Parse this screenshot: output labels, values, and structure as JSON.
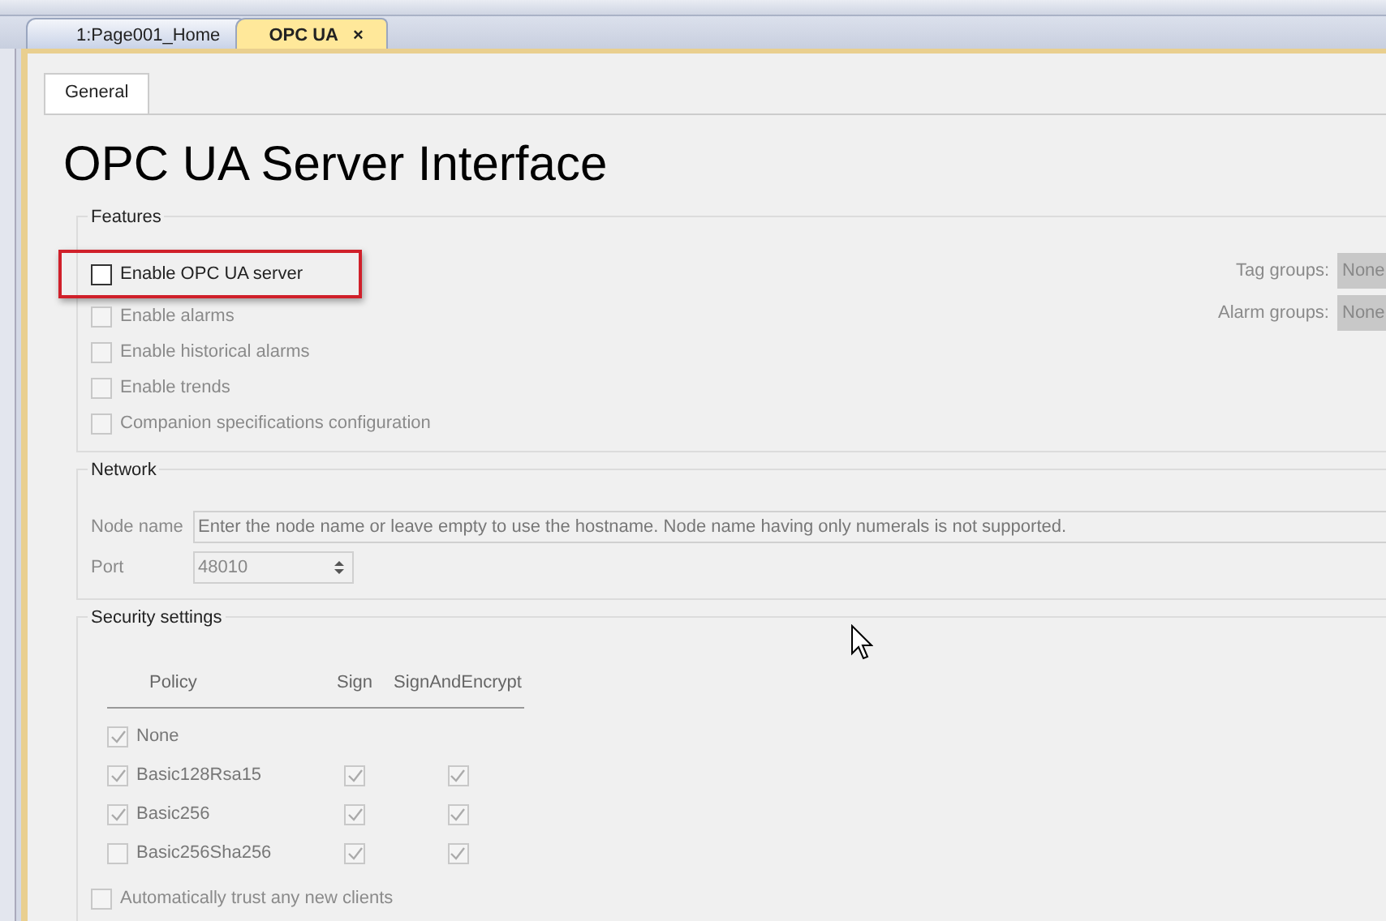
{
  "document_tabs": [
    {
      "label": "1:Page001_Home",
      "selected": false
    },
    {
      "label": "OPC UA",
      "selected": true,
      "close": "×"
    }
  ],
  "page_tabs": [
    {
      "label": "General",
      "selected": true
    }
  ],
  "title": "OPC UA Server Interface",
  "features": {
    "legend": "Features",
    "options": [
      {
        "label": "Enable OPC UA server",
        "checked": false,
        "disabled": false,
        "highlighted": true
      },
      {
        "label": "Enable alarms",
        "checked": false,
        "disabled": true,
        "highlighted": false
      },
      {
        "label": "Enable historical alarms",
        "checked": false,
        "disabled": true,
        "highlighted": false
      },
      {
        "label": "Enable trends",
        "checked": false,
        "disabled": true,
        "highlighted": false
      },
      {
        "label": "Companion specifications configuration",
        "checked": false,
        "disabled": true,
        "highlighted": false
      }
    ],
    "groups": [
      {
        "label": "Tag groups:",
        "value": "None"
      },
      {
        "label": "Alarm groups:",
        "value": "None"
      }
    ]
  },
  "network": {
    "legend": "Network",
    "node_name": {
      "label": "Node name",
      "placeholder": "Enter the node name or leave empty to use the hostname. Node name having only numerals is not supported."
    },
    "port": {
      "label": "Port",
      "value": "48010"
    }
  },
  "security": {
    "legend": "Security settings",
    "columns": [
      "Policy",
      "Sign",
      "SignAndEncrypt"
    ],
    "policies": [
      {
        "kind": "plain",
        "name": "None",
        "checked": true
      },
      {
        "kind": "full",
        "name": "Basic128Rsa15",
        "checked": true,
        "sign": true,
        "encrypt": true
      },
      {
        "kind": "full",
        "name": "Basic256",
        "checked": true,
        "sign": true,
        "encrypt": true
      },
      {
        "kind": "full",
        "name": "Basic256Sha256",
        "checked": false,
        "sign": true,
        "encrypt": true
      }
    ],
    "trust_clients": {
      "label": "Automatically trust any new clients",
      "checked": false
    }
  }
}
